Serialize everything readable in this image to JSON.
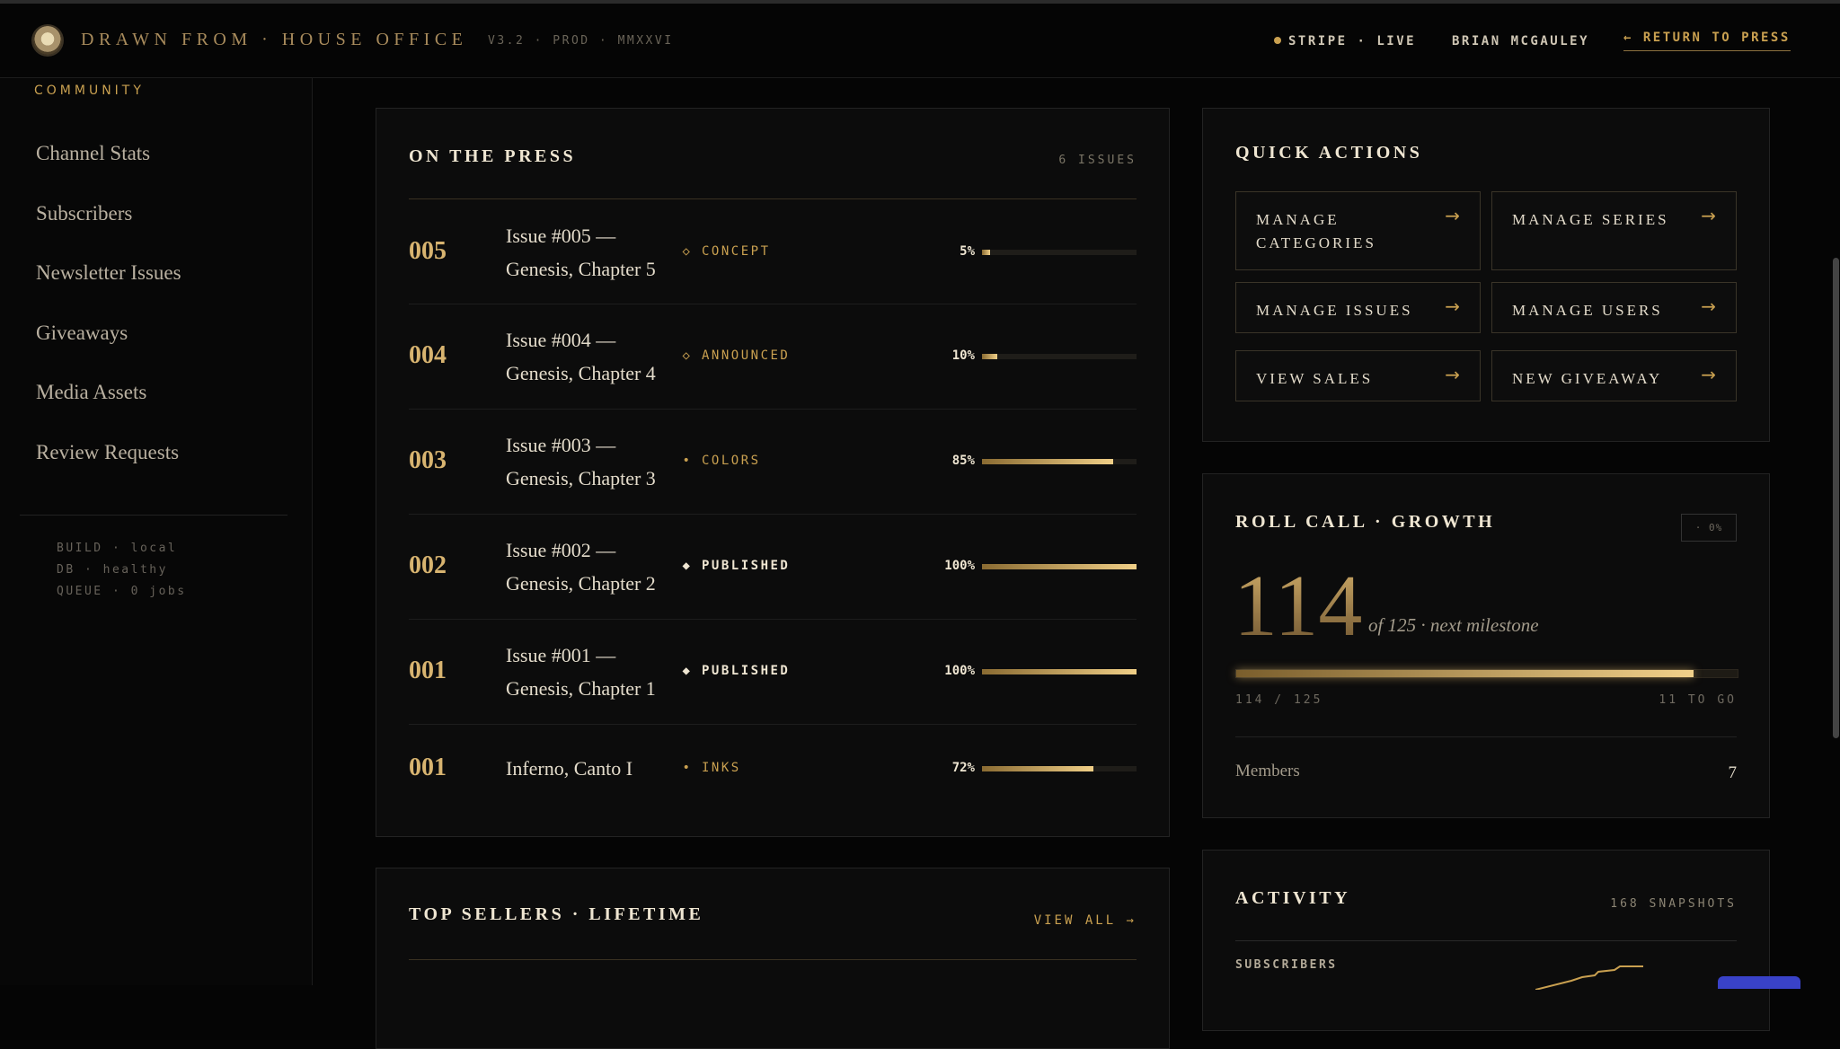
{
  "header": {
    "brand": "DRAWN FROM · HOUSE OFFICE",
    "version": "V3.2 · PROD · MMXXVI",
    "stripe": "STRIPE · LIVE",
    "user": "BRIAN MCGAULEY",
    "return": "← RETURN TO PRESS"
  },
  "sidebar": {
    "section": "COMMUNITY",
    "items": [
      {
        "label": "Channel Stats"
      },
      {
        "label": "Subscribers"
      },
      {
        "label": "Newsletter Issues"
      },
      {
        "label": "Giveaways"
      },
      {
        "label": "Media Assets"
      },
      {
        "label": "Review Requests"
      }
    ],
    "system": {
      "build": "BUILD · local",
      "db": "DB · healthy",
      "queue": "QUEUE · 0 jobs"
    }
  },
  "press": {
    "title": "ON THE PRESS",
    "count": "6 ISSUES",
    "rows": [
      {
        "num": "005",
        "title": "Issue #005 — Genesis, Chapter 5",
        "marker": "◇",
        "status": "CONCEPT",
        "pct": "5%",
        "progress": 0.05,
        "published": false
      },
      {
        "num": "004",
        "title": "Issue #004 — Genesis, Chapter 4",
        "marker": "◇",
        "status": "ANNOUNCED",
        "pct": "10%",
        "progress": 0.1,
        "published": false
      },
      {
        "num": "003",
        "title": "Issue #003 — Genesis, Chapter 3",
        "marker": "•",
        "status": "COLORS",
        "pct": "85%",
        "progress": 0.85,
        "published": false
      },
      {
        "num": "002",
        "title": "Issue #002 — Genesis, Chapter 2",
        "marker": "◆",
        "status": "PUBLISHED",
        "pct": "100%",
        "progress": 1.0,
        "published": true
      },
      {
        "num": "001",
        "title": "Issue #001 — Genesis, Chapter 1",
        "marker": "◆",
        "status": "PUBLISHED",
        "pct": "100%",
        "progress": 1.0,
        "published": true
      },
      {
        "num": "001",
        "title": "Inferno, Canto I",
        "marker": "•",
        "status": "INKS",
        "pct": "72%",
        "progress": 0.72,
        "published": false
      }
    ]
  },
  "sellers": {
    "title": "TOP SELLERS · LIFETIME",
    "view_all": "VIEW ALL →"
  },
  "quick_actions": {
    "title": "QUICK ACTIONS",
    "arrow": "→",
    "buttons": [
      {
        "label": "MANAGE CATEGORIES"
      },
      {
        "label": "MANAGE SERIES"
      },
      {
        "label": "MANAGE ISSUES"
      },
      {
        "label": "MANAGE USERS"
      },
      {
        "label": "VIEW SALES"
      },
      {
        "label": "NEW GIVEAWAY"
      }
    ]
  },
  "roll_call": {
    "title": "ROLL CALL · GROWTH",
    "change": "· 0%",
    "value": "114",
    "milestone": "of 125 · next milestone",
    "progress": 0.912,
    "progress_text": "114 / 125",
    "remaining": "11 TO GO",
    "members_label": "Members",
    "members_value": "7"
  },
  "activity": {
    "title": "ACTIVITY",
    "count": "168 SNAPSHOTS",
    "series_label": "SUBSCRIBERS"
  },
  "colors": {
    "gold": "#c9a050",
    "bg": "#050505",
    "panel": "#0c0c0c"
  }
}
